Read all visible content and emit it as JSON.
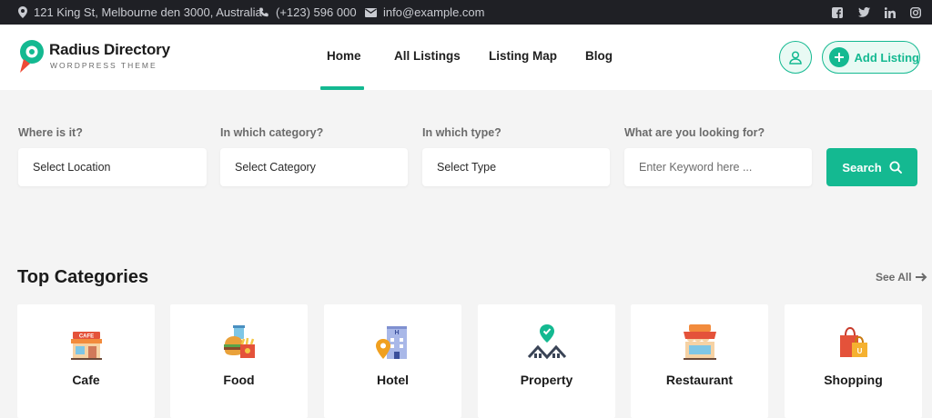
{
  "topbar": {
    "address": "121 King St, Melbourne den 3000, Australia",
    "phone": "(+123) 596 000",
    "email": "info@example.com",
    "social_icons": [
      "facebook-icon",
      "twitter-icon",
      "linkedin-icon",
      "instagram-icon"
    ]
  },
  "header": {
    "brand_name": "Radius Directory",
    "brand_tagline": "WORDPRESS THEME",
    "nav": [
      "Home",
      "All Listings",
      "Listing Map",
      "Blog"
    ],
    "active_nav": "Home",
    "add_listing_label": "Add Listing"
  },
  "search": {
    "location_label": "Where is it?",
    "location_value": "Select Location",
    "category_label": "In which category?",
    "category_value": "Select Category",
    "type_label": "In which type?",
    "type_value": "Select Type",
    "keyword_label": "What are you looking for?",
    "keyword_placeholder": "Enter Keyword here ...",
    "button_label": "Search"
  },
  "categories": {
    "title": "Top Categories",
    "see_all": "See All",
    "items": [
      {
        "label": "Cafe",
        "icon": "cafe-icon",
        "sign": "CAFE"
      },
      {
        "label": "Food",
        "icon": "food-icon"
      },
      {
        "label": "Hotel",
        "icon": "hotel-icon",
        "sign": "H"
      },
      {
        "label": "Property",
        "icon": "property-icon"
      },
      {
        "label": "Restaurant",
        "icon": "restaurant-icon"
      },
      {
        "label": "Shopping",
        "icon": "shopping-icon",
        "sign": "U"
      }
    ]
  },
  "colors": {
    "accent": "#14b991",
    "topbar_bg": "#1f2025",
    "page_bg": "#f4f4f4",
    "logo_red": "#ef4b36"
  }
}
